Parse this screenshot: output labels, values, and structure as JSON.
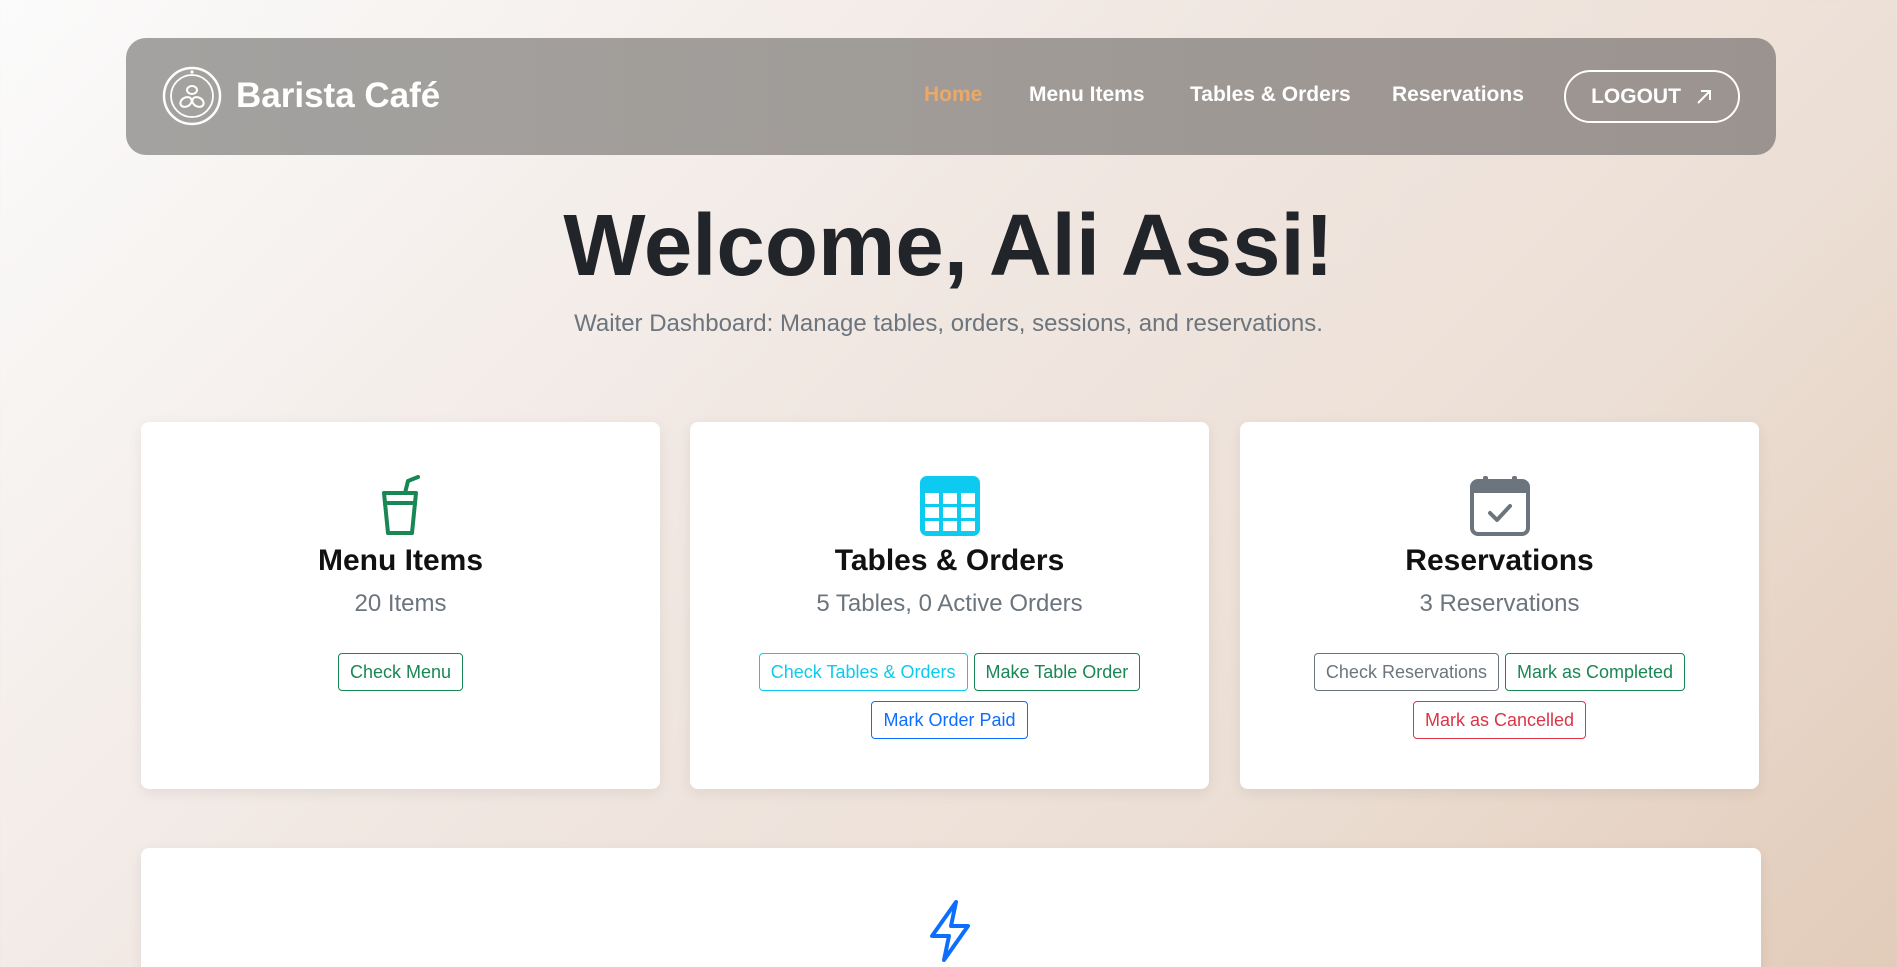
{
  "brand": {
    "name": "Barista Café"
  },
  "nav": {
    "home": "Home",
    "menu_items": "Menu Items",
    "tables_orders": "Tables & Orders",
    "reservations": "Reservations",
    "logout": "LOGOUT"
  },
  "hero": {
    "title": "Welcome, Ali Assi!",
    "subtitle": "Waiter Dashboard: Manage tables, orders, sessions, and reservations."
  },
  "cards": {
    "menu": {
      "title": "Menu Items",
      "stat": "20 Items",
      "icon": "cup-straw-icon",
      "buttons": {
        "check_menu": "Check Menu"
      }
    },
    "tables": {
      "title": "Tables & Orders",
      "stat": "5 Tables, 0 Active Orders",
      "icon": "table-grid-icon",
      "buttons": {
        "check": "Check Tables & Orders",
        "make_order": "Make Table Order",
        "mark_paid": "Mark Order Paid"
      }
    },
    "reservations": {
      "title": "Reservations",
      "stat": "3 Reservations",
      "icon": "calendar-check-icon",
      "buttons": {
        "check": "Check Reservations",
        "completed": "Mark as Completed",
        "cancelled": "Mark as Cancelled"
      }
    }
  },
  "bottom": {
    "icon": "lightning-icon"
  },
  "colors": {
    "accent_orange": "#e9a96a",
    "green": "#198754",
    "cyan": "#0dcaf0",
    "blue": "#0d6efd",
    "gray": "#6c757d",
    "red": "#dc3545"
  }
}
